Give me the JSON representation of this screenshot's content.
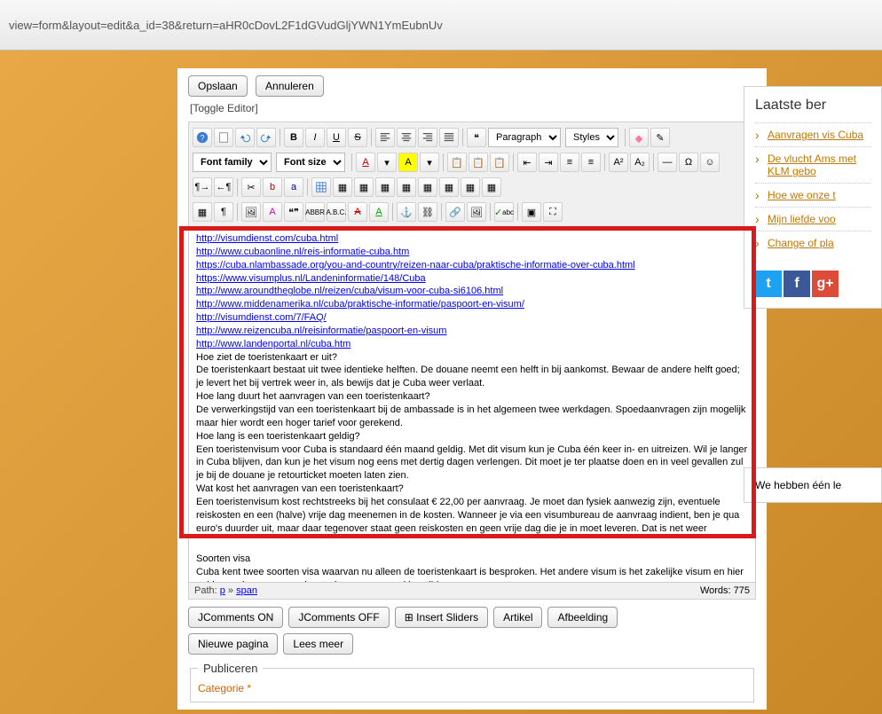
{
  "url": "view=form&layout=edit&a_id=38&return=aHR0cDovL2F1dGVudGljYWN1YmEubnUv",
  "top_buttons": {
    "save": "Opslaan",
    "cancel": "Annuleren"
  },
  "toggle_editor": "[Toggle Editor]",
  "selects": {
    "paragraph": "Paragraph",
    "styles": "Styles",
    "font_family": "Font family",
    "font_size": "Font size"
  },
  "editor_links": [
    "http://visumdienst.com/cuba.html",
    "http://www.cubaonline.nl/reis-informatie-cuba.htm",
    "https://cuba.nlambassade.org/you-and-country/reizen-naar-cuba/praktische-informatie-over-cuba.html",
    "https://www.visumplus.nl/Landeninformatie/148/Cuba",
    "http://www.aroundtheglobe.nl/reizen/cuba/visum-voor-cuba-si6106.html",
    "http://www.middenamerika.nl/cuba/praktische-informatie/paspoort-en-visum/",
    "http://visumdienst.com/7/FAQ/",
    "http://www.reizencuba.nl/reisinformatie/paspoort-en-visum",
    "http://www.landenportal.nl/cuba.htm"
  ],
  "editor_body": "Hoe ziet de toeristenkaart er uit?\nDe toeristenkaart bestaat uit twee identieke helften. De douane neemt een helft in bij aankomst. Bewaar de andere helft goed; je levert het bij vertrek weer in, als bewijs dat je Cuba weer verlaat.\nHoe lang duurt het aanvragen van een toeristenkaart?\nDe verwerkingstijd van een toeristenkaart bij de ambassade is in het algemeen twee werkdagen. Spoedaanvragen zijn mogelijk maar hier wordt een hoger tarief voor gerekend.\nHoe lang is een toeristenkaart geldig?\nEen toeristenvisum voor Cuba is standaard één maand geldig. Met dit visum kun je Cuba één keer in- en uitreizen. Wil je langer in Cuba blijven, dan kun je het visum nog eens met dertig dagen verlengen. Dit moet je ter plaatse doen en in veel gevallen zul je bij de douane je retourticket moeten laten zien.\nWat kost het aanvragen van een toeristenkaart?\nEen toeristenvisum kost rechtstreeks bij het consulaat € 22,00 per aanvraag. Je moet dan fysiek aanwezig zijn, eventuele reiskosten en een (halve) vrije dag meenemen in de kosten. Wanneer je via een visumbureau de aanvraag indient, ben je qua euro's duurder uit, maar daar tegenover staat geen reiskosten en geen vrije dag die je in moet leveren. Dat is net weer",
  "editor_body2": "Soorten visa\nCuba kent twee soorten visa waarvan nu alleen de toeristenkaart is besproken. Het andere visum is het zakelijke visum en hier gelden andere voorwaarden, tarieven en verwerkingstijden voor.\nPaspoort of kopie paspoort?\nVoor nu blijft de vraag:\nIs er een paspoort of een kopie paspoort nodig. Wie heeft hier het antwoord op?",
  "status": {
    "path_label": "Path:",
    "path_p": "p",
    "path_span": "span",
    "words": "Words: 775"
  },
  "bottom": [
    {
      "label": "JComments ON"
    },
    {
      "label": "JComments OFF"
    },
    {
      "label": "Insert Sliders",
      "icon": true
    },
    {
      "label": "Artikel"
    },
    {
      "label": "Afbeelding"
    },
    {
      "label": "Nieuwe pagina"
    },
    {
      "label": "Lees meer"
    }
  ],
  "fieldset": {
    "legend": "Publiceren",
    "cat": "Categorie *"
  },
  "sidebar": {
    "title": "Laatste ber",
    "items": [
      "Aanvragen vis Cuba",
      "De vlucht Ams met KLM gebo",
      "Hoe we onze t",
      "Mijn liefde voo",
      "Change of pla"
    ]
  },
  "footer_note": "We hebben één le"
}
